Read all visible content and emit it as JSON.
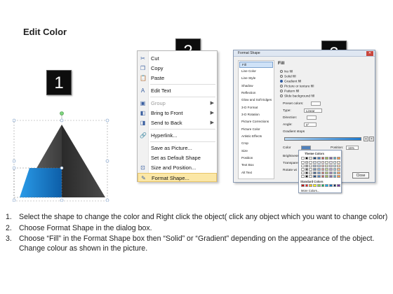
{
  "title": "Edit Color",
  "badges": [
    "1",
    "2",
    "3"
  ],
  "context_menu": {
    "items": [
      {
        "label": "Cut",
        "icon": "scissors-icon"
      },
      {
        "label": "Copy",
        "icon": "copy-icon"
      },
      {
        "label": "Paste",
        "icon": "paste-icon"
      },
      {
        "label": "Edit Text",
        "icon": "edit-text-icon"
      },
      {
        "label": "Group",
        "icon": "group-icon",
        "disabled": true
      },
      {
        "label": "Bring to Front",
        "icon": "bring-front-icon"
      },
      {
        "label": "Send to Back",
        "icon": "send-back-icon"
      },
      {
        "label": "Hyperlink...",
        "icon": "hyperlink-icon"
      },
      {
        "label": "Save as Picture...",
        "icon": ""
      },
      {
        "label": "Set as Default Shape",
        "icon": ""
      },
      {
        "label": "Size and Position...",
        "icon": "size-position-icon"
      },
      {
        "label": "Format Shape...",
        "icon": "format-shape-icon"
      }
    ]
  },
  "format_dialog": {
    "title": "Format Shape",
    "close_glyph": "✕",
    "left_items": [
      "Fill",
      "Line Color",
      "Line Style",
      "Shadow",
      "Reflection",
      "Glow and Soft Edges",
      "3-D Format",
      "3-D Rotation",
      "Picture Corrections",
      "Picture Color",
      "Artistic Effects",
      "Crop",
      "Size",
      "Position",
      "Text Box",
      "Alt Text"
    ],
    "section": "Fill",
    "fill_options": [
      "No fill",
      "Solid fill",
      "Gradient fill",
      "Picture or texture fill",
      "Pattern fill",
      "Slide background fill"
    ],
    "fields": {
      "preset": "Preset colors:",
      "type": "Type:",
      "type_value": "Linear",
      "direction": "Direction:",
      "angle": "Angle:",
      "angle_value": "0°",
      "gradient_stops": "Gradient stops",
      "color": "Color",
      "position": "Position:",
      "position_value": "15%",
      "brightness": "Brightness:",
      "transparency": "Transparen",
      "rotate": "Rotate wi"
    },
    "palette": {
      "theme_label": "Theme Colors",
      "standard_label": "Standard Colors",
      "more": "More Colors...",
      "theme_colors": [
        "#ffffff",
        "#000000",
        "#eeece1",
        "#1f497d",
        "#4f81bd",
        "#c0504d",
        "#9bbb59",
        "#8064a2",
        "#4bacc6",
        "#f79646"
      ],
      "standard_colors": [
        "#c00000",
        "#ff0000",
        "#ffc000",
        "#ffff00",
        "#92d050",
        "#00b050",
        "#00b0f0",
        "#0070c0",
        "#002060",
        "#7030a0"
      ]
    },
    "close_label": "Close"
  },
  "steps": [
    {
      "num": "1.",
      "text": "Select the shape to change the color and Right click the object( click any object which you want to change color)"
    },
    {
      "num": "2.",
      "text": "Choose Format Shape in the dialog box."
    },
    {
      "num": "3.",
      "text": "Choose “Fill” in the Format Shape box then “Solid” or “Gradient” depending on the appearance of the object. Change colour as shown in the picture."
    }
  ]
}
